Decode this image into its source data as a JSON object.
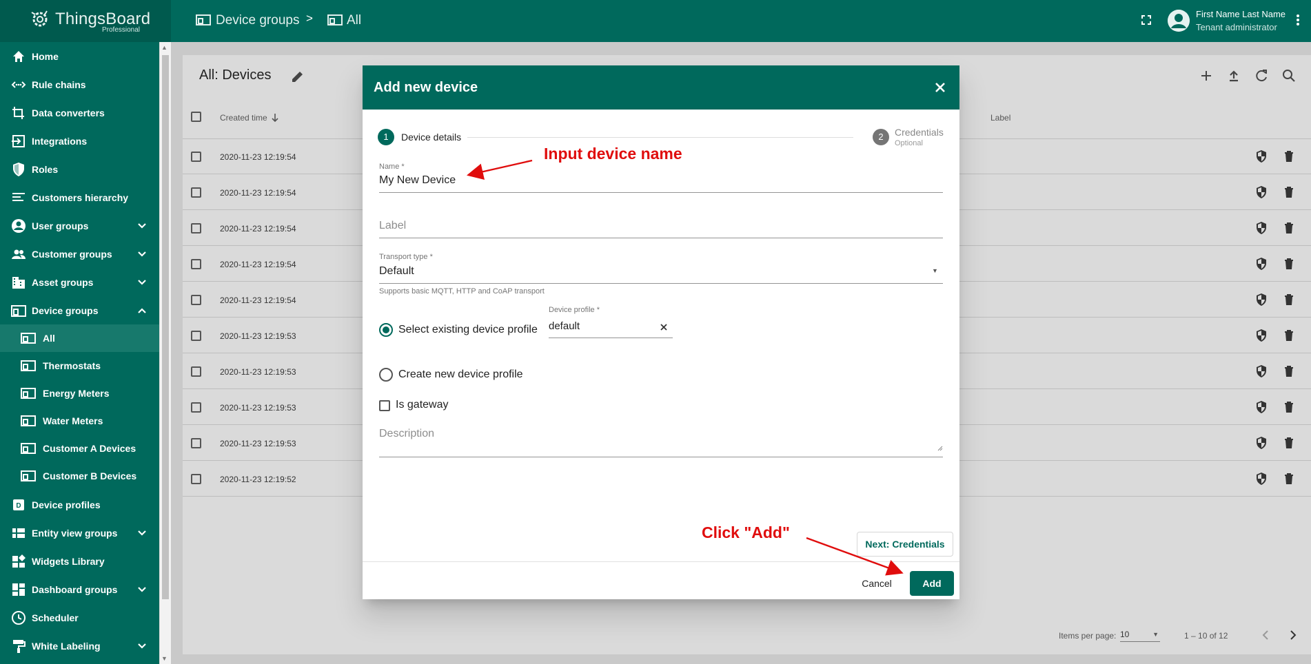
{
  "app": {
    "name": "ThingsBoard",
    "edition": "Professional"
  },
  "breadcrumb": {
    "parent": "Device groups",
    "separator": ">",
    "current": "All"
  },
  "user": {
    "name": "First Name Last Name",
    "role": "Tenant administrator"
  },
  "sidebar": {
    "items": [
      {
        "label": "Home",
        "icon": "home-icon"
      },
      {
        "label": "Rule chains",
        "icon": "rule-chain-icon"
      },
      {
        "label": "Data converters",
        "icon": "converter-icon"
      },
      {
        "label": "Integrations",
        "icon": "integration-icon"
      },
      {
        "label": "Roles",
        "icon": "shield-icon"
      },
      {
        "label": "Customers hierarchy",
        "icon": "hierarchy-icon"
      },
      {
        "label": "User groups",
        "icon": "account-icon"
      },
      {
        "label": "Customer groups",
        "icon": "people-icon"
      },
      {
        "label": "Asset groups",
        "icon": "domain-icon"
      },
      {
        "label": "Device groups",
        "icon": "devices-icon"
      },
      {
        "label": "All",
        "icon": "devices-icon"
      },
      {
        "label": "Thermostats",
        "icon": "devices-icon"
      },
      {
        "label": "Energy Meters",
        "icon": "devices-icon"
      },
      {
        "label": "Water Meters",
        "icon": "devices-icon"
      },
      {
        "label": "Customer A Devices",
        "icon": "devices-icon"
      },
      {
        "label": "Customer B Devices",
        "icon": "devices-icon"
      },
      {
        "label": "Device profiles",
        "icon": "device-profile-icon"
      },
      {
        "label": "Entity view groups",
        "icon": "view-icon"
      },
      {
        "label": "Widgets Library",
        "icon": "widgets-icon"
      },
      {
        "label": "Dashboard groups",
        "icon": "dashboard-icon"
      },
      {
        "label": "Scheduler",
        "icon": "clock-icon"
      },
      {
        "label": "White Labeling",
        "icon": "paint-icon"
      }
    ]
  },
  "panel": {
    "title": "All: Devices",
    "columns": {
      "created": "Created time",
      "label": "Label"
    },
    "rows": [
      "2020-11-23 12:19:54",
      "2020-11-23 12:19:54",
      "2020-11-23 12:19:54",
      "2020-11-23 12:19:54",
      "2020-11-23 12:19:54",
      "2020-11-23 12:19:53",
      "2020-11-23 12:19:53",
      "2020-11-23 12:19:53",
      "2020-11-23 12:19:53",
      "2020-11-23 12:19:52"
    ],
    "pager": {
      "items_label": "Items per page:",
      "per_page": "10",
      "range": "1 – 10 of 12"
    }
  },
  "dialog": {
    "title": "Add new device",
    "steps": [
      {
        "num": "1",
        "label": "Device details"
      },
      {
        "num": "2",
        "label": "Credentials",
        "sub": "Optional"
      }
    ],
    "name_label": "Name *",
    "name_value": "My New Device",
    "label_placeholder": "Label",
    "transport_label": "Transport type *",
    "transport_value": "Default",
    "transport_hint": "Supports basic MQTT, HTTP and CoAP transport",
    "select_existing": "Select existing device profile",
    "profile_label": "Device profile *",
    "profile_value": "default",
    "create_new": "Create new device profile",
    "gateway": "Is gateway",
    "description_placeholder": "Description",
    "next_button": "Next: Credentials",
    "cancel_button": "Cancel",
    "add_button": "Add"
  },
  "annotations": {
    "input_name": "Input device name",
    "click_add": "Click \"Add\""
  },
  "colors": {
    "primary": "#00695c",
    "annotation": "#e00d0d"
  }
}
